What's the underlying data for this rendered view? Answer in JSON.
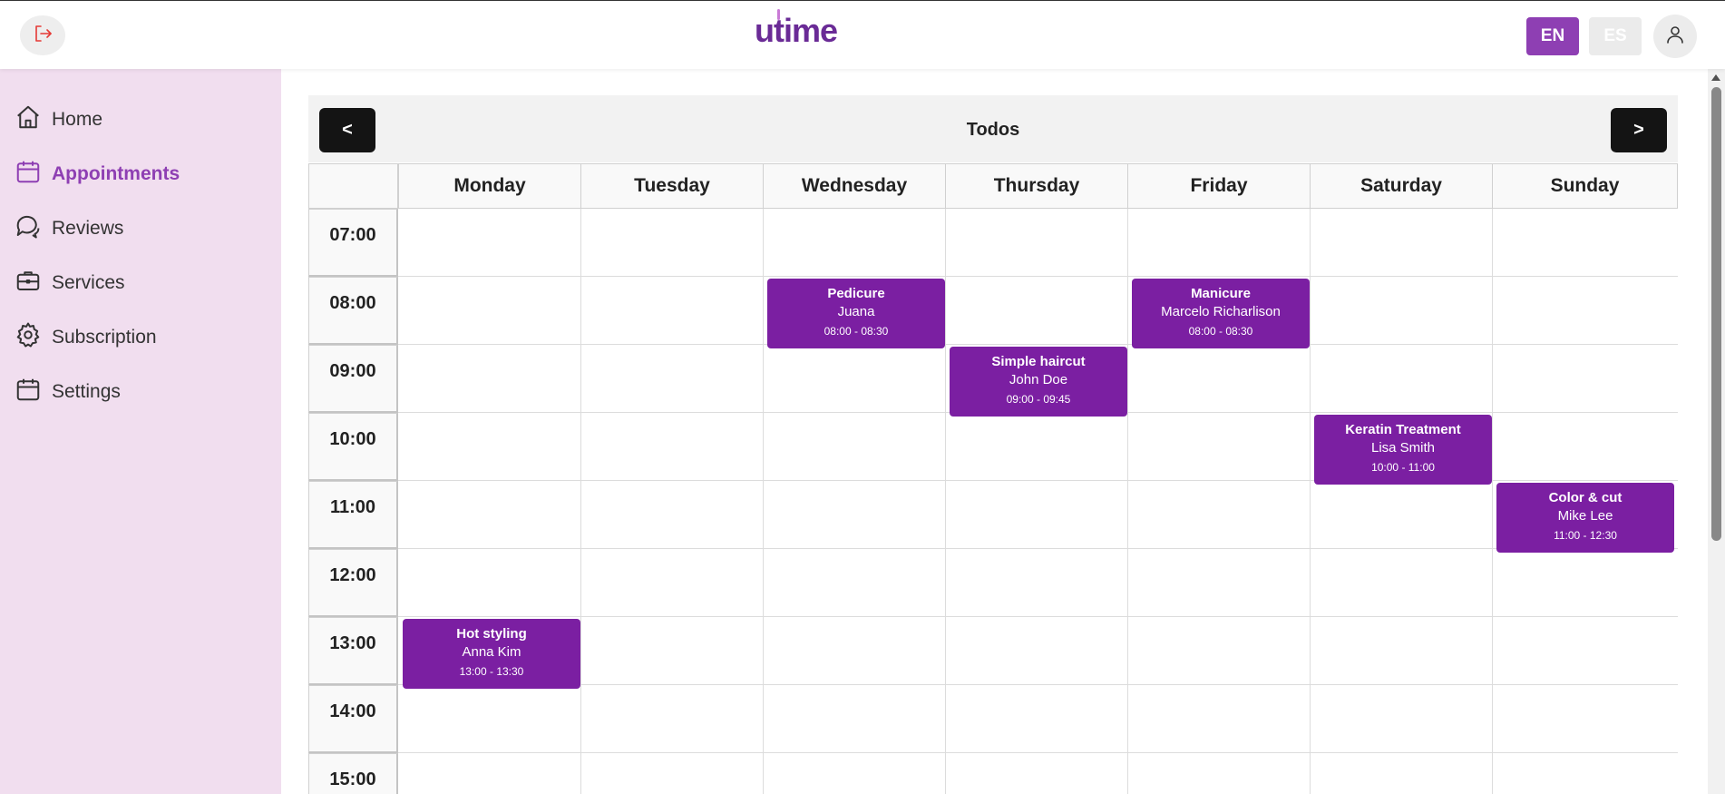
{
  "header": {
    "logo_text": "utime",
    "languages": [
      "EN",
      "ES"
    ]
  },
  "sidebar": {
    "items": [
      {
        "label": "Home",
        "icon": "home-icon"
      },
      {
        "label": "Appointments",
        "icon": "calendar-icon",
        "active": true
      },
      {
        "label": "Reviews",
        "icon": "chat-icon"
      },
      {
        "label": "Services",
        "icon": "briefcase-icon"
      },
      {
        "label": "Subscription",
        "icon": "gear-icon"
      },
      {
        "label": "Settings",
        "icon": "calendar-icon"
      }
    ]
  },
  "calendar": {
    "title": "Todos",
    "prev_label": "<",
    "next_label": ">",
    "days": [
      "Monday",
      "Tuesday",
      "Wednesday",
      "Thursday",
      "Friday",
      "Saturday",
      "Sunday"
    ],
    "times": [
      "07:00",
      "08:00",
      "09:00",
      "10:00",
      "11:00",
      "12:00",
      "13:00",
      "14:00",
      "15:00"
    ],
    "appointments": [
      {
        "service": "Pedicure",
        "client": "Juana",
        "time": "08:00 - 08:30",
        "day": "Wednesday"
      },
      {
        "service": "Manicure",
        "client": "Marcelo Richarlison",
        "time": "08:00 - 08:30",
        "day": "Friday"
      },
      {
        "service": "Simple haircut",
        "client": "John Doe",
        "time": "09:00 - 09:45",
        "day": "Thursday"
      },
      {
        "service": "Keratin Treatment",
        "client": "Lisa Smith",
        "time": "10:00 - 11:00",
        "day": "Saturday"
      },
      {
        "service": "Color & cut",
        "client": "Mike Lee",
        "time": "11:00 - 12:30",
        "day": "Sunday"
      },
      {
        "service": "Hot styling",
        "client": "Anna Kim",
        "time": "13:00 - 13:30",
        "day": "Monday"
      }
    ]
  },
  "colors": {
    "accent": "#8e3fb3",
    "appointment_bg": "#7b1fa2",
    "sidebar_bg": "#f1deef",
    "logout_icon": "#e53935"
  }
}
